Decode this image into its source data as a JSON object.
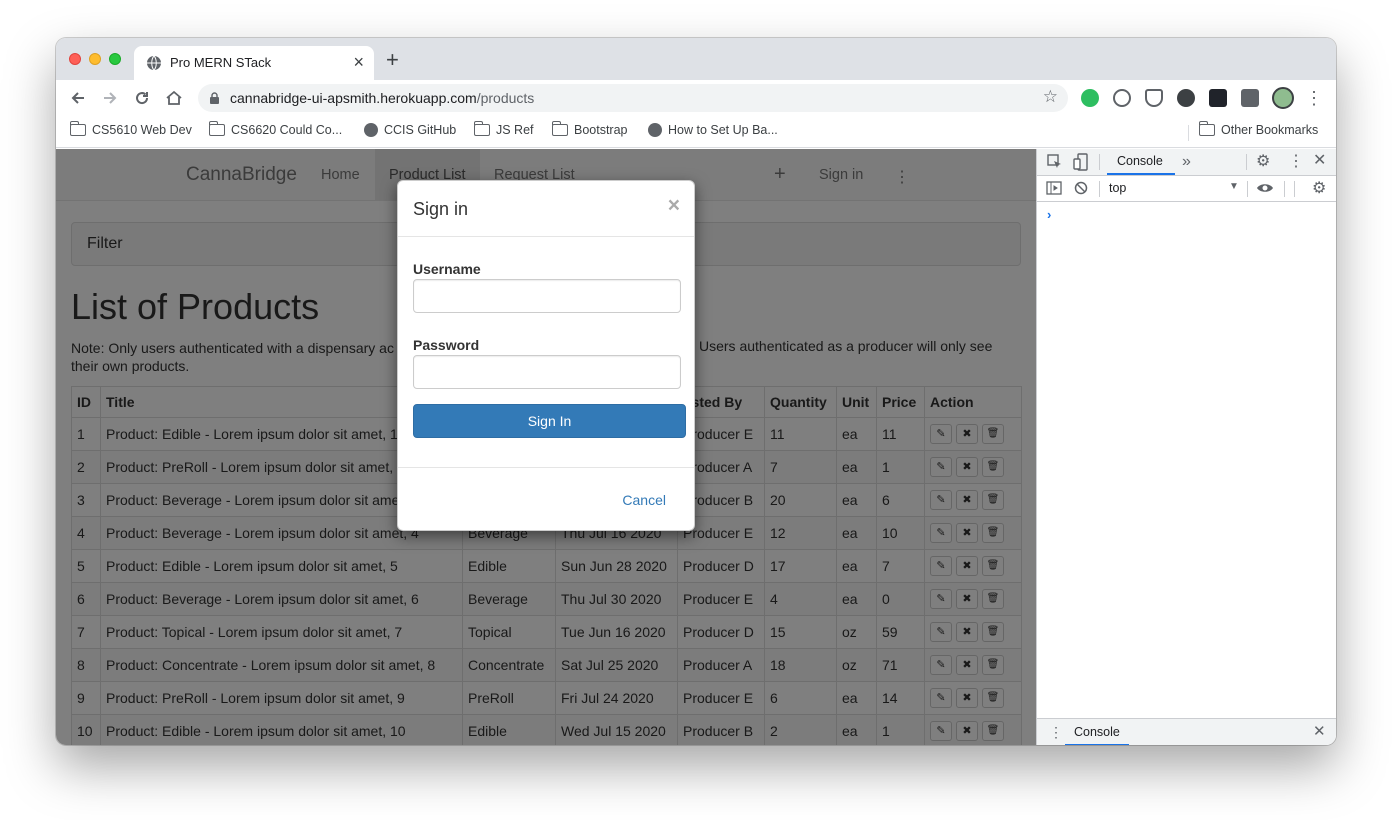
{
  "browser": {
    "tab_title": "Pro MERN STack",
    "url_host": "cannabridge-ui-apsmith.herokuapp.com",
    "url_path": "/products",
    "bookmarks": [
      {
        "label": "CS5610 Web Dev",
        "icon": "folder-icon"
      },
      {
        "label": "CS6620 Could Co...",
        "icon": "folder-icon"
      },
      {
        "label": "CCIS GitHub",
        "icon": "globe-icon"
      },
      {
        "label": "JS Ref",
        "icon": "folder-icon"
      },
      {
        "label": "Bootstrap",
        "icon": "folder-icon"
      },
      {
        "label": "How to Set Up Ba...",
        "icon": "globe-icon"
      }
    ],
    "other_bookmarks": "Other Bookmarks"
  },
  "app": {
    "brand": "CannaBridge",
    "nav": {
      "home": "Home",
      "product_list": "Product List",
      "request_list": "Request List",
      "add": "+",
      "sign_in": "Sign in",
      "more": "⋮"
    },
    "filter_title": "Filter",
    "heading": "List of Products",
    "note_left": "Note: Only users authenticated with a dispensary ac",
    "note_right": "Users authenticated as a producer will only see",
    "note_line2": "their own products.",
    "table": {
      "headers": [
        "ID",
        "Title",
        "",
        "",
        "osted By",
        "Quantity",
        "Unit",
        "Price",
        "Action"
      ],
      "rows": [
        [
          "1",
          "Product: Edible - Lorem ipsum dolor sit amet, 1",
          "",
          "",
          "Producer E",
          "11",
          "ea",
          "11"
        ],
        [
          "2",
          "Product: PreRoll - Lorem ipsum dolor sit amet,",
          "",
          "",
          "Producer A",
          "7",
          "ea",
          "1"
        ],
        [
          "3",
          "Product: Beverage - Lorem ipsum dolor sit amet",
          "",
          "",
          "Producer B",
          "20",
          "ea",
          "6"
        ],
        [
          "4",
          "Product: Beverage - Lorem ipsum dolor sit amet, 4",
          "Beverage",
          "Thu Jul 16 2020",
          "Producer E",
          "12",
          "ea",
          "10"
        ],
        [
          "5",
          "Product: Edible - Lorem ipsum dolor sit amet, 5",
          "Edible",
          "Sun Jun 28 2020",
          "Producer D",
          "17",
          "ea",
          "7"
        ],
        [
          "6",
          "Product: Beverage - Lorem ipsum dolor sit amet, 6",
          "Beverage",
          "Thu Jul 30 2020",
          "Producer E",
          "4",
          "ea",
          "0"
        ],
        [
          "7",
          "Product: Topical - Lorem ipsum dolor sit amet, 7",
          "Topical",
          "Tue Jun 16 2020",
          "Producer D",
          "15",
          "oz",
          "59"
        ],
        [
          "8",
          "Product: Concentrate - Lorem ipsum dolor sit amet, 8",
          "Concentrate",
          "Sat Jul 25 2020",
          "Producer A",
          "18",
          "oz",
          "71"
        ],
        [
          "9",
          "Product: PreRoll - Lorem ipsum dolor sit amet, 9",
          "PreRoll",
          "Fri Jul 24 2020",
          "Producer E",
          "6",
          "ea",
          "14"
        ],
        [
          "10",
          "Product: Edible - Lorem ipsum dolor sit amet, 10",
          "Edible",
          "Wed Jul 15 2020",
          "Producer B",
          "2",
          "ea",
          "1"
        ]
      ]
    }
  },
  "modal": {
    "title": "Sign in",
    "close": "×",
    "username_label": "Username",
    "username_value": "",
    "password_label": "Password",
    "password_value": "",
    "submit": "Sign In",
    "cancel": "Cancel"
  },
  "devtools": {
    "tab": "Console",
    "more_tabs": "»",
    "context": "top",
    "drawer_tab": "Console",
    "prompt": "›"
  },
  "colors": {
    "primary": "#337ab7",
    "overlay": "rgba(0,0,0,0.5)",
    "devtools_accent": "#1a73e8"
  }
}
